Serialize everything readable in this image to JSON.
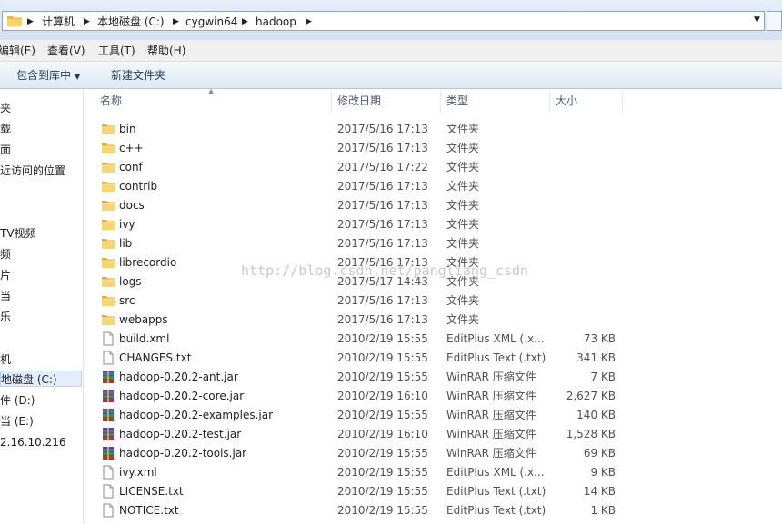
{
  "address": {
    "crumbs": [
      "计算机",
      "本地磁盘 (C:)",
      "cygwin64",
      "hadoop"
    ]
  },
  "menu": [
    "编辑(E)",
    "查看(V)",
    "工具(T)",
    "帮助(H)"
  ],
  "commands": {
    "include_library": "包含到库中",
    "new_folder": "新建文件夹"
  },
  "nav": [
    "夹",
    "载",
    "面",
    "近访问的位置",
    "TV视频",
    "频",
    "片",
    "当",
    "乐",
    "机",
    "地磁盘 (C:)",
    "件 (D:)",
    "当 (E:)",
    "2.16.10.216"
  ],
  "columns": {
    "name": "名称",
    "date": "修改日期",
    "type": "类型",
    "size": "大小"
  },
  "files": [
    {
      "name": "bin",
      "date": "2017/5/16 17:13",
      "type": "文件夹",
      "size": "",
      "icon": "folder-icon"
    },
    {
      "name": "c++",
      "date": "2017/5/16 17:13",
      "type": "文件夹",
      "size": "",
      "icon": "folder-icon"
    },
    {
      "name": "conf",
      "date": "2017/5/16 17:22",
      "type": "文件夹",
      "size": "",
      "icon": "folder-icon"
    },
    {
      "name": "contrib",
      "date": "2017/5/16 17:13",
      "type": "文件夹",
      "size": "",
      "icon": "folder-icon"
    },
    {
      "name": "docs",
      "date": "2017/5/16 17:13",
      "type": "文件夹",
      "size": "",
      "icon": "folder-icon"
    },
    {
      "name": "ivy",
      "date": "2017/5/16 17:13",
      "type": "文件夹",
      "size": "",
      "icon": "folder-icon"
    },
    {
      "name": "lib",
      "date": "2017/5/16 17:13",
      "type": "文件夹",
      "size": "",
      "icon": "folder-icon"
    },
    {
      "name": "librecordio",
      "date": "2017/5/16 17:13",
      "type": "文件夹",
      "size": "",
      "icon": "folder-icon"
    },
    {
      "name": "logs",
      "date": "2017/5/17 14:43",
      "type": "文件夹",
      "size": "",
      "icon": "folder-icon"
    },
    {
      "name": "src",
      "date": "2017/5/16 17:13",
      "type": "文件夹",
      "size": "",
      "icon": "folder-icon"
    },
    {
      "name": "webapps",
      "date": "2017/5/16 17:13",
      "type": "文件夹",
      "size": "",
      "icon": "folder-icon"
    },
    {
      "name": "build.xml",
      "date": "2010/2/19 15:55",
      "type": "EditPlus XML (.x...",
      "size": "73 KB",
      "icon": "document-icon"
    },
    {
      "name": "CHANGES.txt",
      "date": "2010/2/19 15:55",
      "type": "EditPlus Text (.txt)",
      "size": "341 KB",
      "icon": "document-icon"
    },
    {
      "name": "hadoop-0.20.2-ant.jar",
      "date": "2010/2/19 15:55",
      "type": "WinRAR 压缩文件",
      "size": "7 KB",
      "icon": "archive-icon"
    },
    {
      "name": "hadoop-0.20.2-core.jar",
      "date": "2010/2/19 16:10",
      "type": "WinRAR 压缩文件",
      "size": "2,627 KB",
      "icon": "archive-icon"
    },
    {
      "name": "hadoop-0.20.2-examples.jar",
      "date": "2010/2/19 15:55",
      "type": "WinRAR 压缩文件",
      "size": "140 KB",
      "icon": "archive-icon"
    },
    {
      "name": "hadoop-0.20.2-test.jar",
      "date": "2010/2/19 16:10",
      "type": "WinRAR 压缩文件",
      "size": "1,528 KB",
      "icon": "archive-icon"
    },
    {
      "name": "hadoop-0.20.2-tools.jar",
      "date": "2010/2/19 15:55",
      "type": "WinRAR 压缩文件",
      "size": "69 KB",
      "icon": "archive-icon"
    },
    {
      "name": "ivy.xml",
      "date": "2010/2/19 15:55",
      "type": "EditPlus XML (.x...",
      "size": "9 KB",
      "icon": "document-icon"
    },
    {
      "name": "LICENSE.txt",
      "date": "2010/2/19 15:55",
      "type": "EditPlus Text (.txt)",
      "size": "14 KB",
      "icon": "document-icon"
    },
    {
      "name": "NOTICE.txt",
      "date": "2010/2/19 15:55",
      "type": "EditPlus Text (.txt)",
      "size": "1 KB",
      "icon": "document-icon"
    }
  ],
  "watermark": "http://blog.csdn.net/pangliang_csdn"
}
